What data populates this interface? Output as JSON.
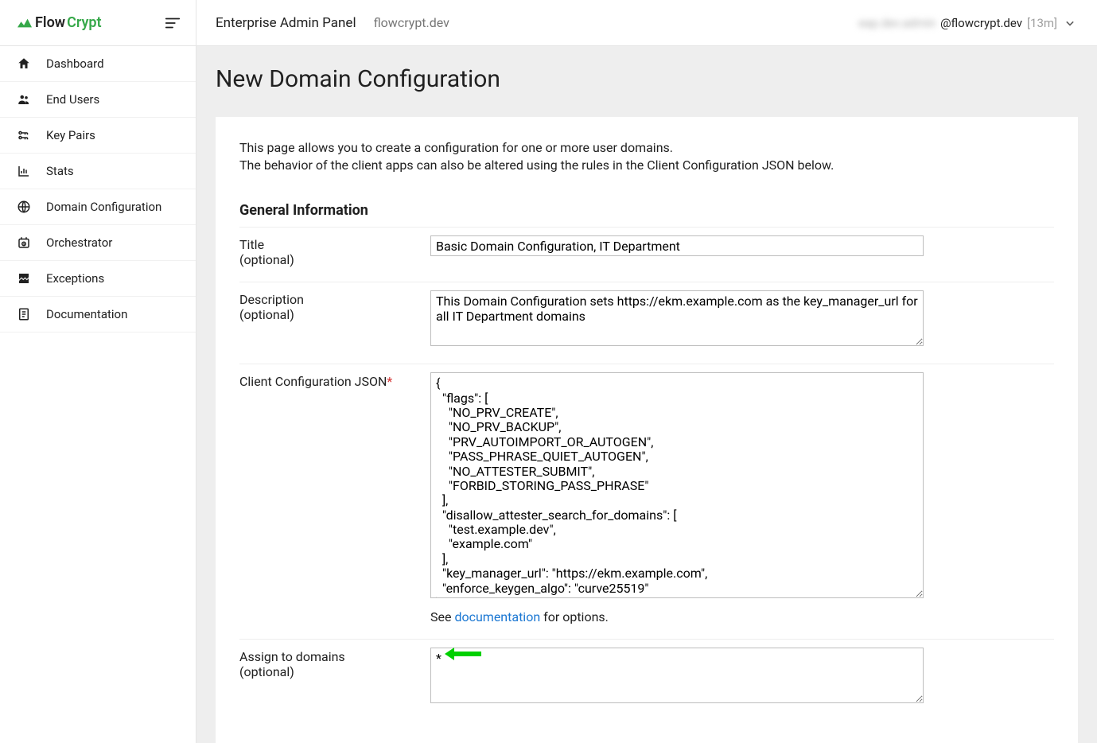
{
  "brand": {
    "flow": "Flow",
    "crypt": "Crypt"
  },
  "sidebar": {
    "items": [
      {
        "label": "Dashboard"
      },
      {
        "label": "End Users"
      },
      {
        "label": "Key Pairs"
      },
      {
        "label": "Stats"
      },
      {
        "label": "Domain Configuration"
      },
      {
        "label": "Orchestrator"
      },
      {
        "label": "Exceptions"
      },
      {
        "label": "Documentation"
      }
    ]
  },
  "topbar": {
    "title": "Enterprise Admin Panel",
    "sub": "flowcrypt.dev",
    "user_blurred": "eap.dev.admin",
    "user_domain": "@flowcrypt.dev",
    "user_time": "[13m]"
  },
  "page": {
    "title": "New Domain Configuration",
    "intro_line1": "This page allows you to create a configuration for one or more user domains.",
    "intro_line2": "The behavior of the client apps can also be altered using the rules in the Client Configuration JSON below."
  },
  "form": {
    "section_title": "General Information",
    "title_label": "Title",
    "title_sub": "(optional)",
    "title_value": "Basic Domain Configuration, IT Department",
    "desc_label": "Description",
    "desc_sub": "(optional)",
    "desc_value": "This Domain Configuration sets https://ekm.example.com as the key_manager_url for all IT Department domains",
    "json_label": "Client Configuration JSON",
    "json_value": "{\n  \"flags\": [\n    \"NO_PRV_CREATE\",\n    \"NO_PRV_BACKUP\",\n    \"PRV_AUTOIMPORT_OR_AUTOGEN\",\n    \"PASS_PHRASE_QUIET_AUTOGEN\",\n    \"NO_ATTESTER_SUBMIT\",\n    \"FORBID_STORING_PASS_PHRASE\"\n  ],\n  \"disallow_attester_search_for_domains\": [\n    \"test.example.dev\",\n    \"example.com\"\n  ],\n  \"key_manager_url\": \"https://ekm.example.com\",\n  \"enforce_keygen_algo\": \"curve25519\"\n}",
    "doc_see": "See ",
    "doc_link": "documentation",
    "doc_after": " for options.",
    "domains_label": "Assign to domains",
    "domains_sub": "(optional)",
    "domains_value": "*"
  }
}
